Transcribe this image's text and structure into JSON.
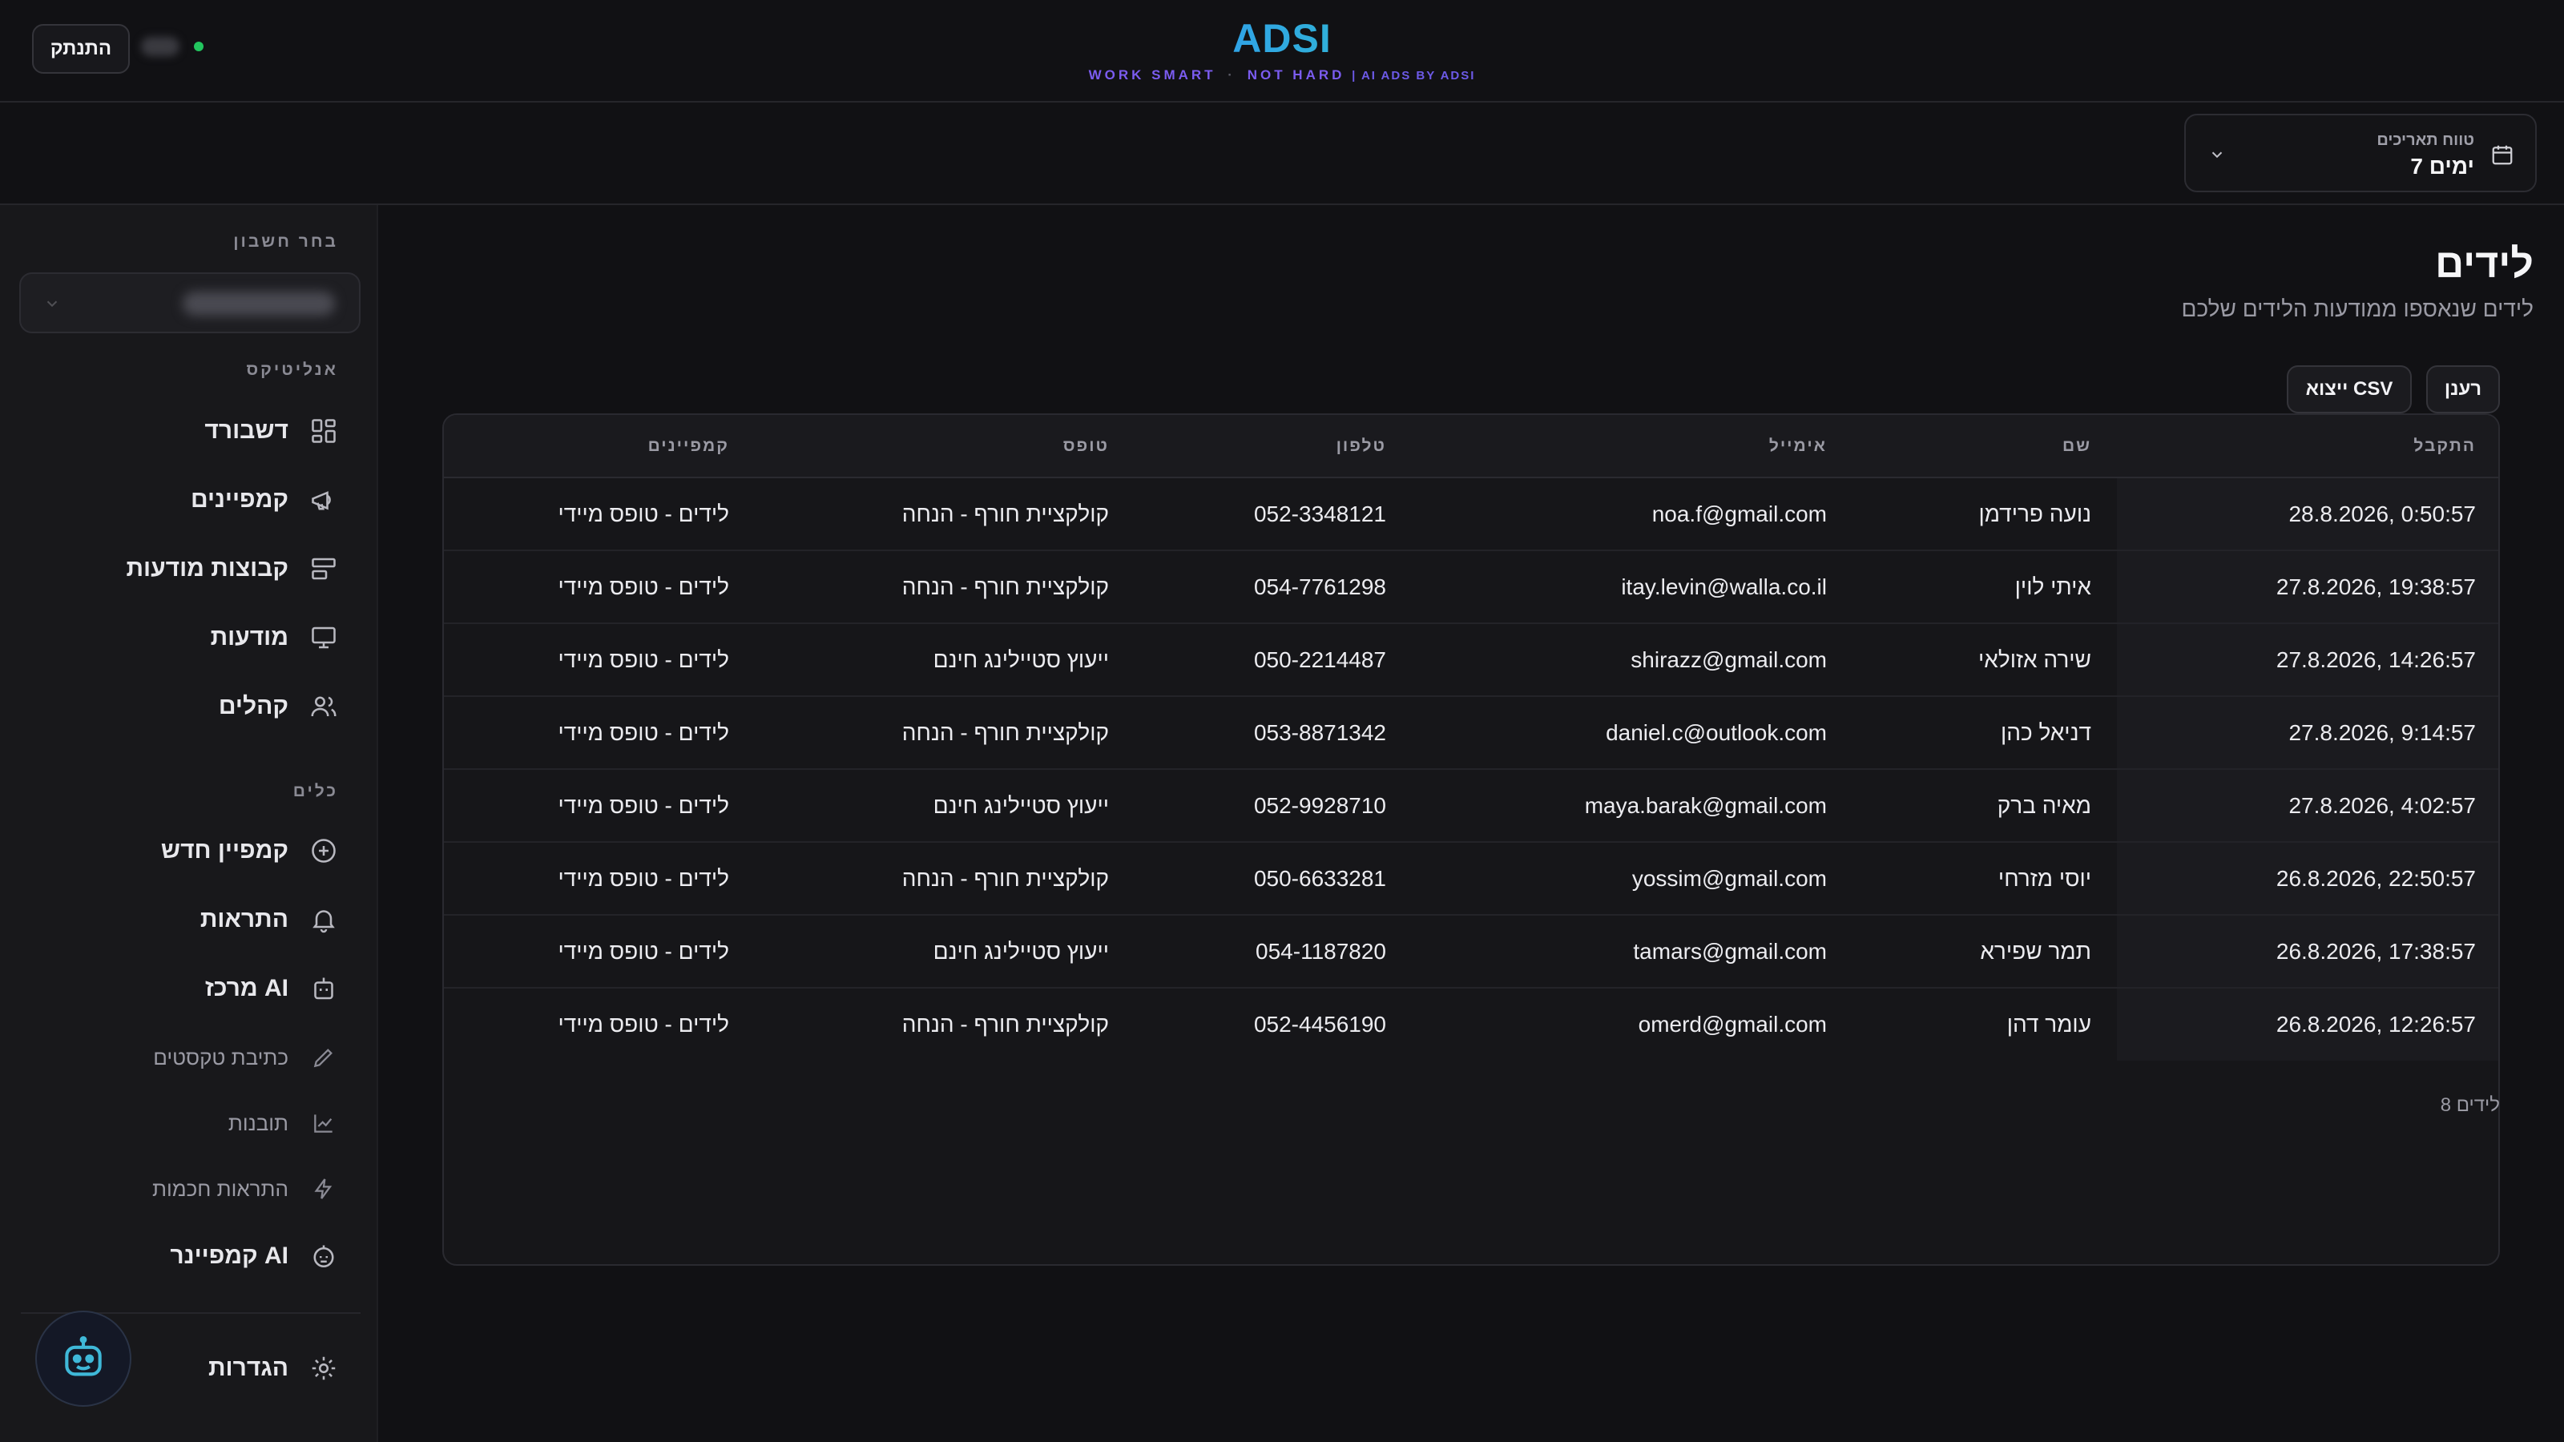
{
  "header": {
    "logout_label": "התנתק",
    "logo_title": "ADSI",
    "logo_tagline_a": "WORK SMART",
    "logo_tagline_sep": "·",
    "logo_tagline_b": "NOT HARD",
    "logo_tagline_c": "| AI ADS BY ADSI"
  },
  "date_range": {
    "label": "טווח תאריכים",
    "value": "7 ימים"
  },
  "sidebar": {
    "account_section_label": "בחר חשבון",
    "analytics_label": "אנליטיקס",
    "tools_label": "כלים",
    "analytics_items": [
      {
        "label": "דשבורד",
        "icon": "dashboard-icon"
      },
      {
        "label": "קמפיינים",
        "icon": "megaphone-icon"
      },
      {
        "label": "קבוצות מודעות",
        "icon": "ad-groups-icon"
      },
      {
        "label": "מודעות",
        "icon": "monitor-icon"
      },
      {
        "label": "קהלים",
        "icon": "users-icon"
      }
    ],
    "tools_items": [
      {
        "label": "קמפיין חדש",
        "icon": "plus-circle-icon"
      },
      {
        "label": "התראות",
        "icon": "bell-icon"
      },
      {
        "label": "מרכז AI",
        "icon": "robot-icon"
      }
    ],
    "ai_sub_items": [
      {
        "label": "כתיבת טקסטים",
        "icon": "pencil-icon"
      },
      {
        "label": "תובנות",
        "icon": "line-chart-icon"
      },
      {
        "label": "התראות חכמות",
        "icon": "lightning-icon"
      }
    ],
    "campaigner_label": "קמפיינר AI",
    "settings_label": "הגדרות"
  },
  "main": {
    "title": "לידים",
    "subtitle": "לידים שנאספו ממודעות הלידים שלכם",
    "refresh_label": "רענן",
    "export_label": "ייצוא CSV",
    "columns": [
      "התקבל",
      "שם",
      "אימייל",
      "טלפון",
      "טופס",
      "קמפיינים"
    ],
    "rows": [
      [
        "28.8.2026, 0:50:57",
        "נועה פרידמן",
        "noa.f@gmail.com",
        "052-3348121",
        "קולקציית חורף - הנחה",
        "לידים - טופס מיידי"
      ],
      [
        "27.8.2026, 19:38:57",
        "איתי לוין",
        "itay.levin@walla.co.il",
        "054-7761298",
        "קולקציית חורף - הנחה",
        "לידים - טופס מיידי"
      ],
      [
        "27.8.2026, 14:26:57",
        "שירה אזולאי",
        "shirazz@gmail.com",
        "050-2214487",
        "ייעוץ סטיילינג חינם",
        "לידים - טופס מיידי"
      ],
      [
        "27.8.2026, 9:14:57",
        "דניאל כהן",
        "daniel.c@outlook.com",
        "053-8871342",
        "קולקציית חורף - הנחה",
        "לידים - טופס מיידי"
      ],
      [
        "27.8.2026, 4:02:57",
        "מאיה ברק",
        "maya.barak@gmail.com",
        "052-9928710",
        "ייעוץ סטיילינג חינם",
        "לידים - טופס מיידי"
      ],
      [
        "26.8.2026, 22:50:57",
        "יוסי מזרחי",
        "yossim@gmail.com",
        "050-6633281",
        "קולקציית חורף - הנחה",
        "לידים - טופס מיידי"
      ],
      [
        "26.8.2026, 17:38:57",
        "תמר שפירא",
        "tamars@gmail.com",
        "054-1187820",
        "ייעוץ סטיילינג חינם",
        "לידים - טופס מיידי"
      ],
      [
        "26.8.2026, 12:26:57",
        "עומר דהן",
        "omerd@gmail.com",
        "052-4456190",
        "קולקציית חורף - הנחה",
        "לידים - טופס מיידי"
      ]
    ],
    "count_label": "8 לידים"
  },
  "colors": {
    "background": "#111114",
    "sidebar": "#18181b",
    "brand_blue": "#2f8bff",
    "brand_purple": "#7b5cf0",
    "online": "#22c55e"
  }
}
